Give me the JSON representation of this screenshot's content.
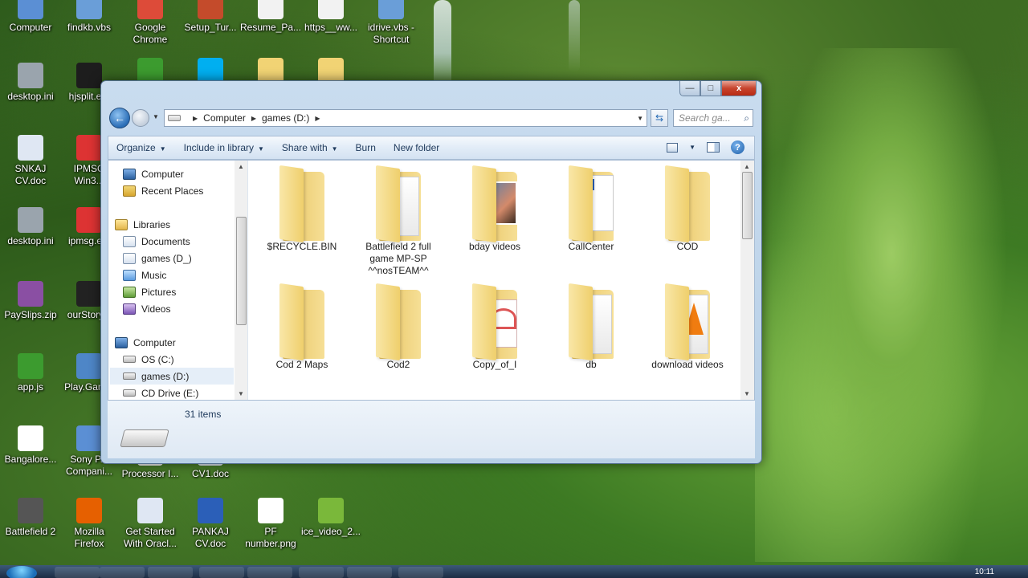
{
  "desktop": {
    "icons": [
      {
        "label": "Computer",
        "icon": "computer-icon",
        "color": "#5b8fd4"
      },
      {
        "label": "findkb.vbs",
        "icon": "script-icon",
        "color": "#6a9ed8"
      },
      {
        "label": "Google Chrome",
        "icon": "chrome-icon",
        "color": "#dd4b39"
      },
      {
        "label": "Setup_Tur...",
        "icon": "setup-icon",
        "color": "#c44b2b"
      },
      {
        "label": "Resume_Pa...",
        "icon": "document-icon",
        "color": "#f2f2f2"
      },
      {
        "label": "https__ww...",
        "icon": "pdf-icon",
        "color": "#f2f2f2"
      },
      {
        "label": "idrive.vbs - Shortcut",
        "icon": "script-icon",
        "color": "#6a9ed8"
      },
      {
        "label": "desktop.ini",
        "icon": "gear-file-icon",
        "color": "#9aa4ad"
      },
      {
        "label": "hjsplit.e...",
        "icon": "check-icon",
        "color": "#1d1d1d"
      },
      {
        "label": "",
        "icon": "app-green-icon",
        "color": "#3c9b2f"
      },
      {
        "label": "",
        "icon": "skype-icon",
        "color": "#00aff0"
      },
      {
        "label": "",
        "icon": "folder-icon",
        "color": "#f1d374"
      },
      {
        "label": "",
        "icon": "folder-icon",
        "color": "#f1d374"
      },
      {
        "label": "SNKAJ CV.doc",
        "icon": "word-doc-icon",
        "color": "#dfe7f3"
      },
      {
        "label": "IPMSG Win3...",
        "icon": "ipmsg-icon",
        "color": "#d33"
      },
      {
        "label": "desktop.ini",
        "icon": "gear-file-icon",
        "color": "#9aa4ad"
      },
      {
        "label": "ipmsg.e...",
        "icon": "ipmsg-icon",
        "color": "#d33"
      },
      {
        "label": "PaySlips.zip",
        "icon": "winrar-icon",
        "color": "#8a4fa3"
      },
      {
        "label": "ourStory...",
        "icon": "dos-icon",
        "color": "#222"
      },
      {
        "label": "app.js",
        "icon": "js-file-icon",
        "color": "#3c9b2f"
      },
      {
        "label": "Play.Gam...",
        "icon": "game-icon",
        "color": "#4e86c7"
      },
      {
        "label": "Bangalore...",
        "icon": "blank-doc-icon",
        "color": "#ffffff"
      },
      {
        "label": "Sony P... Compani...",
        "icon": "shortcut-icon",
        "color": "#5b8fd4"
      },
      {
        "label": "Processor I...",
        "icon": "document-icon",
        "color": "#f2f2f2"
      },
      {
        "label": "CV1.doc",
        "icon": "word-doc-icon",
        "color": "#dfe7f3"
      },
      {
        "label": "Battlefield 2",
        "icon": "battlefield-icon",
        "color": "#555"
      },
      {
        "label": "Mozilla Firefox",
        "icon": "firefox-icon",
        "color": "#e66000"
      },
      {
        "label": "Get Started With Oracl...",
        "icon": "oracle-icon",
        "color": "#dfe7f3"
      },
      {
        "label": "PANKAJ CV.doc",
        "icon": "word-doc-icon",
        "color": "#2b5fb8"
      },
      {
        "label": "PF number.png",
        "icon": "image-file-icon",
        "color": "#ffffff"
      },
      {
        "label": "ice_video_2...",
        "icon": "video-app-icon",
        "color": "#7ab83a"
      }
    ]
  },
  "window": {
    "caption": {
      "minimize": "—",
      "maximize": "□",
      "close": "x"
    },
    "nav": {
      "back": "←"
    },
    "address": {
      "crumbs": [
        "Computer",
        "games (D:)"
      ]
    },
    "search": {
      "placeholder": "Search ga..."
    },
    "toolbar": {
      "items": [
        "Organize",
        "Include in library",
        "Share with",
        "Burn",
        "New folder"
      ],
      "help": "?"
    },
    "navpane": {
      "items": [
        {
          "label": "Computer",
          "icon": "computer-icon"
        },
        {
          "label": "Recent Places",
          "icon": "recent-places-icon"
        },
        {
          "label": "Libraries",
          "icon": "libraries-icon"
        },
        {
          "label": "Documents",
          "icon": "documents-icon"
        },
        {
          "label": "games (D_)",
          "icon": "documents-icon"
        },
        {
          "label": "Music",
          "icon": "music-icon"
        },
        {
          "label": "Pictures",
          "icon": "pictures-icon"
        },
        {
          "label": "Videos",
          "icon": "videos-icon"
        },
        {
          "label": "Computer",
          "icon": "computer-icon"
        },
        {
          "label": "OS (C:)",
          "icon": "drive-icon"
        },
        {
          "label": "games (D:)",
          "icon": "drive-icon",
          "selected": true
        },
        {
          "label": "CD Drive (E:)",
          "icon": "cd-drive-icon"
        }
      ]
    },
    "files": [
      {
        "label": "$RECYCLE.BIN",
        "kind": "plain"
      },
      {
        "label": "Battlefield 2 full game MP-SP ^^nosTEAM^^",
        "kind": "paper"
      },
      {
        "label": "bday videos",
        "kind": "photo"
      },
      {
        "label": "CallCenter",
        "kind": "word"
      },
      {
        "label": "COD",
        "kind": "plain"
      },
      {
        "label": "Cod 2 Maps",
        "kind": "plain"
      },
      {
        "label": "Cod2",
        "kind": "plain"
      },
      {
        "label": "Copy_of_I",
        "kind": "pdf"
      },
      {
        "label": "db",
        "kind": "paper"
      },
      {
        "label": "download videos",
        "kind": "vlc"
      },
      {
        "label": "",
        "kind": "plain"
      },
      {
        "label": "",
        "kind": "paper"
      },
      {
        "label": "",
        "kind": "paper"
      },
      {
        "label": "",
        "kind": "paper"
      },
      {
        "label": "",
        "kind": "paper"
      }
    ],
    "details": {
      "count": "31 items"
    }
  },
  "taskbar": {
    "clock": "10:11"
  }
}
